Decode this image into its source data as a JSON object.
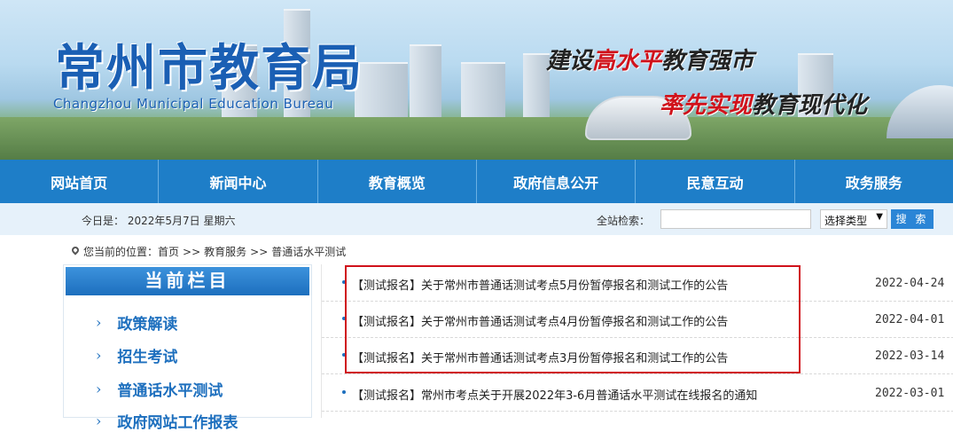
{
  "header": {
    "title": "常州市教育局",
    "title_en": "Changzhou Municipal Education Bureau",
    "slogan1_pre": "建设",
    "slogan1_hl": "高水平",
    "slogan1_post": "教育强市",
    "slogan2_hl": "率先实现",
    "slogan2_post": "教育现代化"
  },
  "nav": [
    "网站首页",
    "新闻中心",
    "教育概览",
    "政府信息公开",
    "民意互动",
    "政务服务"
  ],
  "infobar": {
    "today": "今日是： 2022年5月7日 星期六",
    "search_label": "全站检索：",
    "search_value": "",
    "select_value": "选择类型",
    "search_button": "搜 索"
  },
  "breadcrumb": [
    "您当前的位置：首页",
    ">>",
    "教育服务",
    ">>",
    "普通话水平测试"
  ],
  "sidebar": {
    "title": "当前栏目",
    "items": [
      "政策解读",
      "招生考试",
      "普通话水平测试",
      "政府网站工作报表"
    ]
  },
  "list": [
    {
      "title": "【测试报名】关于常州市普通话测试考点5月份暂停报名和测试工作的公告",
      "date": "2022-04-24"
    },
    {
      "title": "【测试报名】关于常州市普通话测试考点4月份暂停报名和测试工作的公告",
      "date": "2022-04-01"
    },
    {
      "title": "【测试报名】关于常州市普通话测试考点3月份暂停报名和测试工作的公告",
      "date": "2022-03-14"
    },
    {
      "title": "【测试报名】常州市考点关于开展2022年3-6月普通话水平测试在线报名的通知",
      "date": "2022-03-01"
    }
  ],
  "colors": {
    "brand": "#1e7ec8",
    "highlight": "#d0121b"
  }
}
